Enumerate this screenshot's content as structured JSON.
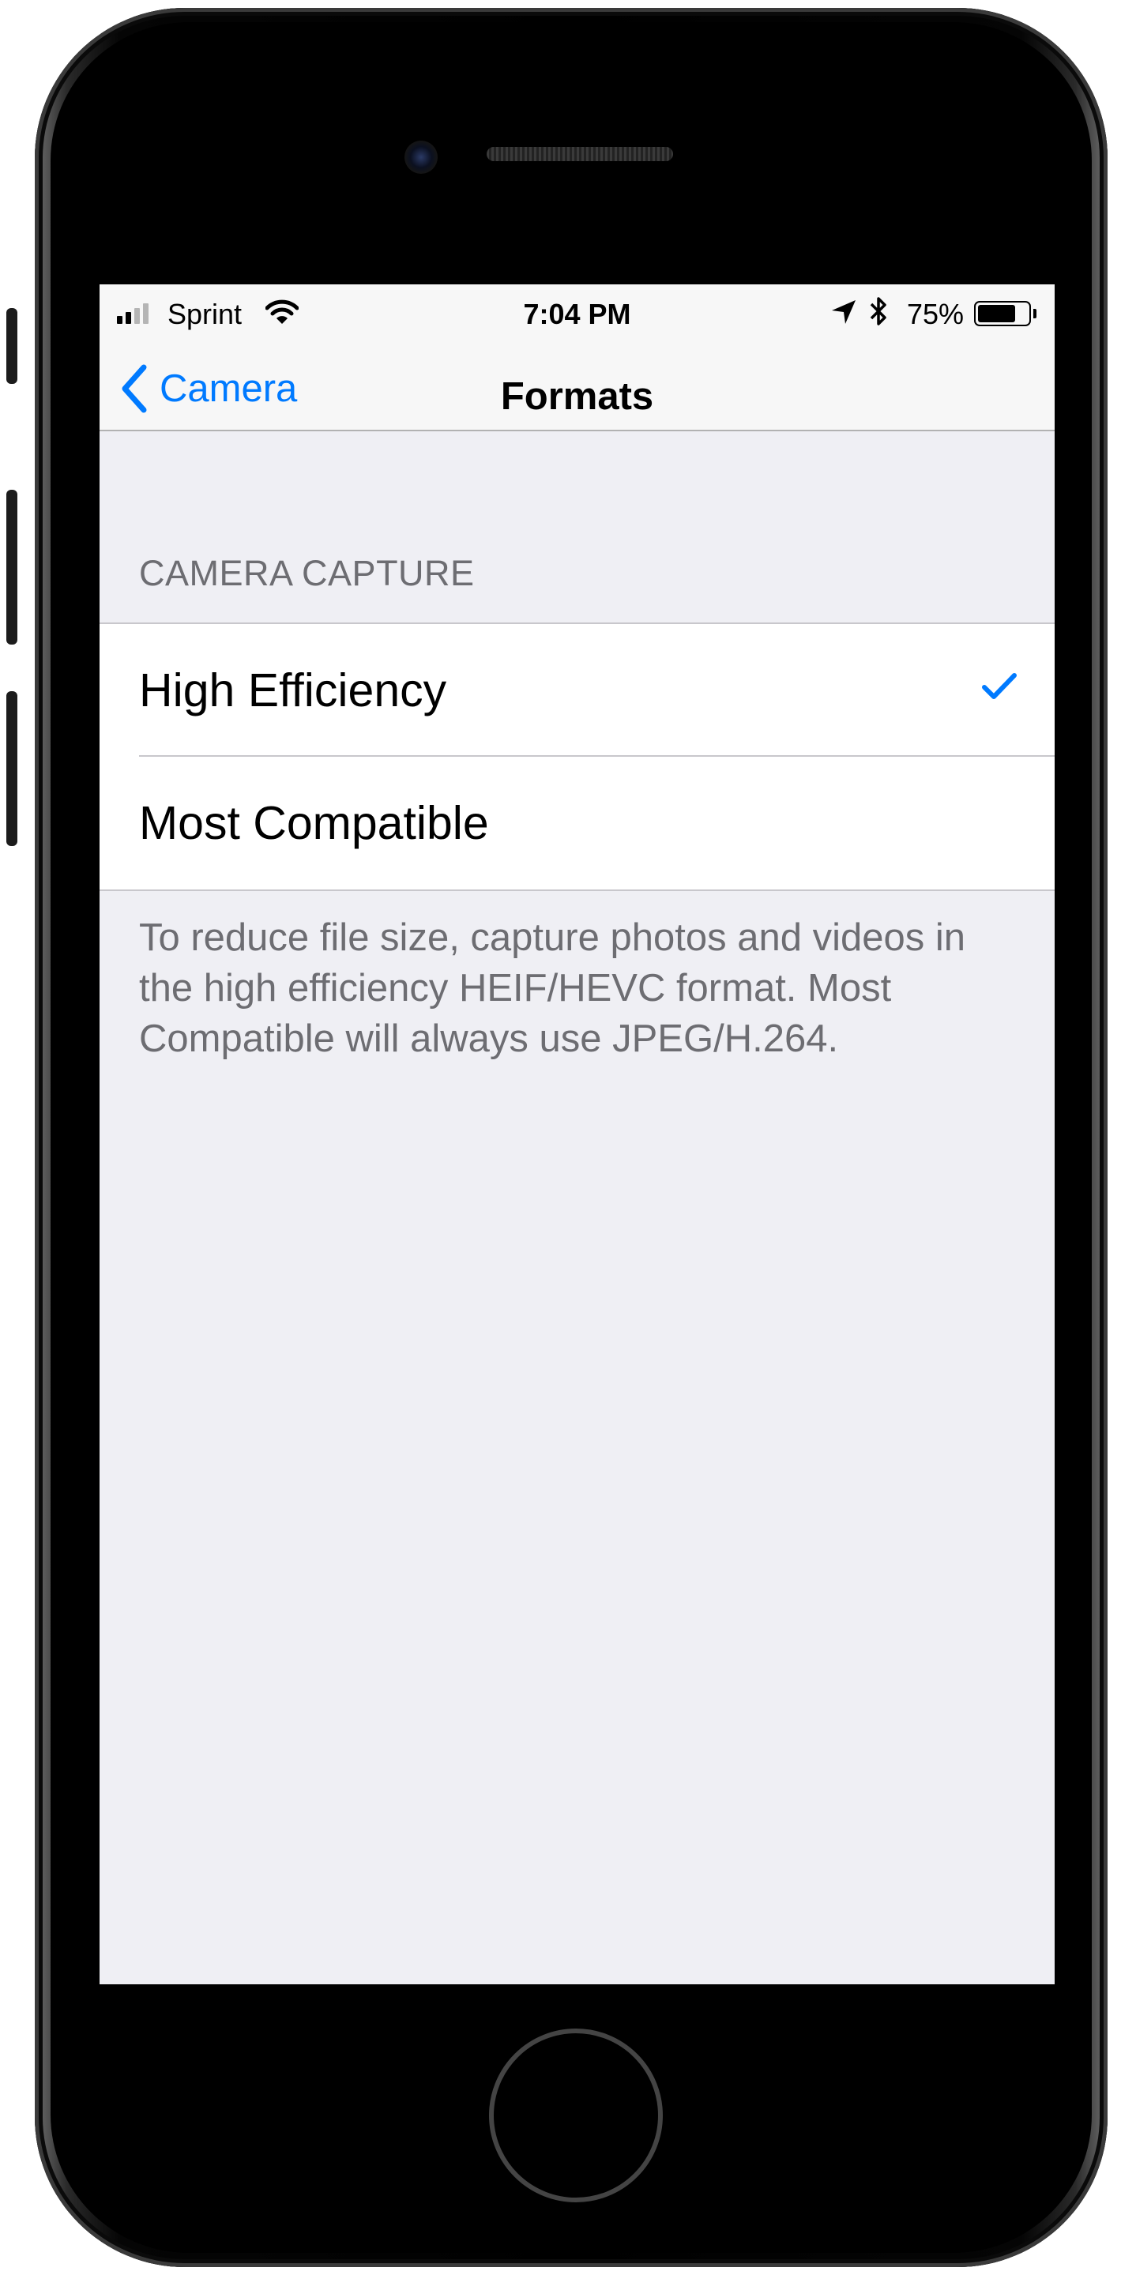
{
  "status_bar": {
    "carrier": "Sprint",
    "time": "7:04 PM",
    "battery_percent_label": "75%",
    "battery_level": 0.75,
    "icons": [
      "signal-bars-icon",
      "wifi-icon",
      "location-arrow-icon",
      "bluetooth-icon",
      "battery-icon"
    ]
  },
  "navbar": {
    "back_label": "Camera",
    "title": "Formats"
  },
  "section": {
    "header": "CAMERA CAPTURE",
    "options": [
      {
        "label": "High Efficiency",
        "selected": true
      },
      {
        "label": "Most Compatible",
        "selected": false
      }
    ],
    "footer": "To reduce file size, capture photos and videos in the high efficiency HEIF/HEVC format. Most Compatible will always use JPEG/H.264."
  },
  "colors": {
    "accent": "#007aff",
    "background": "#efeff4",
    "secondary_text": "#6d6d72"
  }
}
